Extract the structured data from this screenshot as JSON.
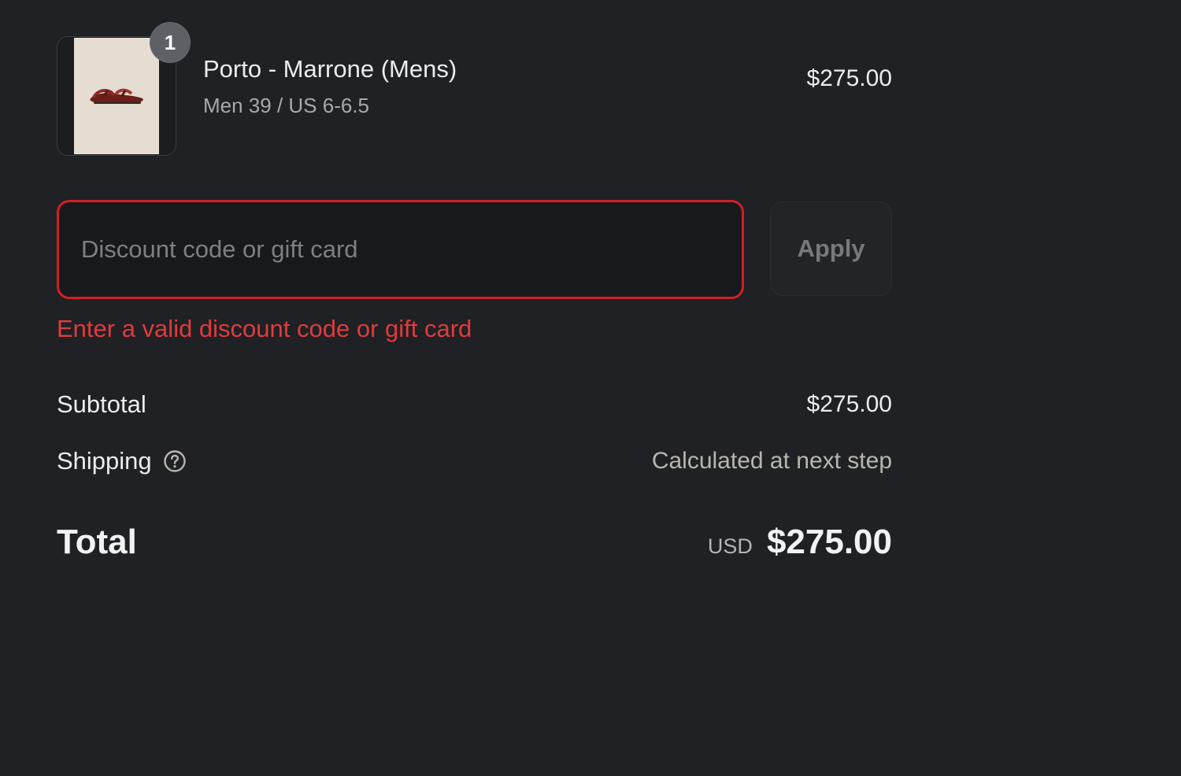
{
  "product": {
    "quantity": "1",
    "name": "Porto - Marrone (Mens)",
    "variant": "Men 39 / US 6-6.5",
    "price": "$275.00",
    "image_icon": "sandal-product-image"
  },
  "discount": {
    "placeholder": "Discount code or gift card",
    "value": "",
    "apply_label": "Apply",
    "error": "Enter a valid discount code or gift card"
  },
  "totals": {
    "subtotal_label": "Subtotal",
    "subtotal_value": "$275.00",
    "shipping_label": "Shipping",
    "shipping_value": "Calculated at next step",
    "total_label": "Total",
    "currency": "USD",
    "total_value": "$275.00"
  },
  "colors": {
    "background": "#1f2124",
    "error": "#d21f26",
    "muted_text": "#a9a9a9"
  }
}
